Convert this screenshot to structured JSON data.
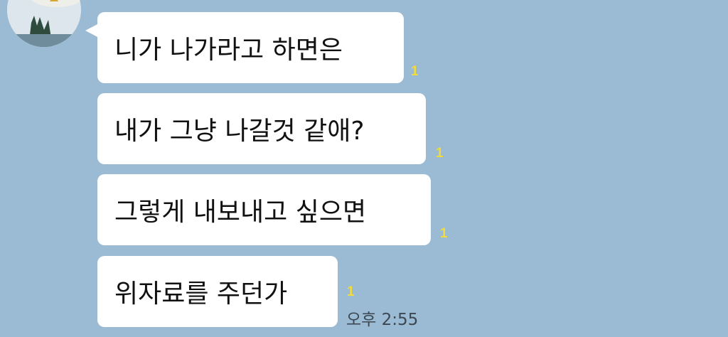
{
  "chat": {
    "sender_name": "",
    "messages": [
      {
        "text": "니가 나가라고 하면은",
        "unread": "1"
      },
      {
        "text": "내가 그냥 나갈것 같애?",
        "unread": "1"
      },
      {
        "text": "그렇게 내보내고 싶으면",
        "unread": "1"
      },
      {
        "text": "위자료를 주던가",
        "unread": "1"
      }
    ],
    "timestamp": "오후 2:55"
  },
  "colors": {
    "background": "#9bbbd4",
    "bubble": "#ffffff",
    "unread_count": "#f2dc3a"
  },
  "icons": {
    "avatar": "profile-photo"
  }
}
